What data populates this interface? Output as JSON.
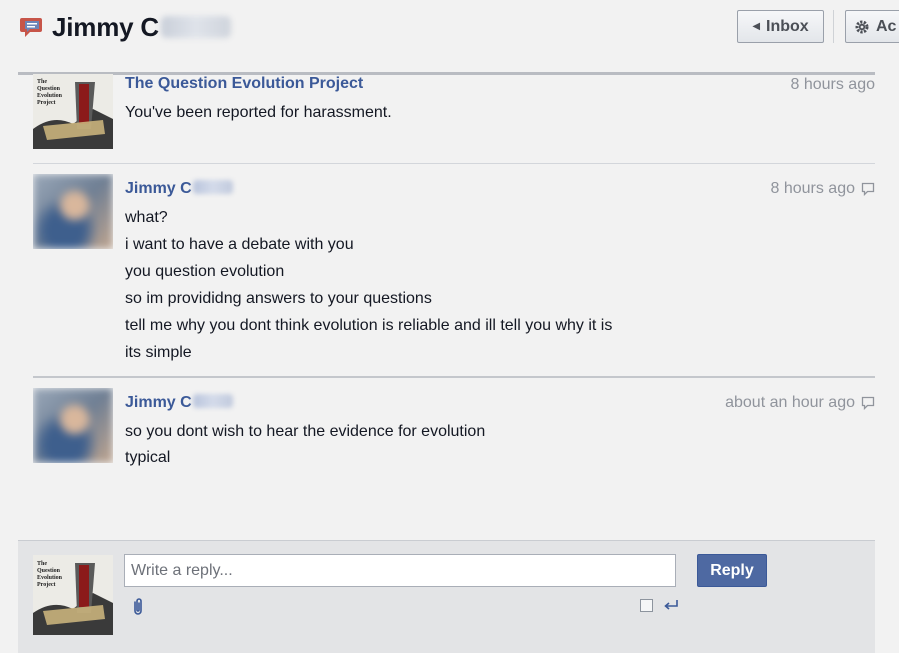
{
  "header": {
    "title": "Jimmy C",
    "inbox_label": "Inbox",
    "actions_label": "Ac"
  },
  "messages": [
    {
      "sender": "The Question Evolution Project",
      "time": "8 hours ago",
      "lines": [
        "You've been reported for harassment."
      ]
    },
    {
      "sender": "Jimmy C",
      "time": "8 hours ago",
      "lines": [
        "what?",
        "i want to have a debate with you",
        "you question evolution",
        "so im provididng answers to your questions",
        "tell me why you dont think evolution is reliable and ill tell you why it is",
        "its simple"
      ]
    },
    {
      "sender": "Jimmy C",
      "time": "about an hour ago",
      "lines": [
        "so you dont wish to hear the evidence for evolution",
        "typical"
      ]
    }
  ],
  "avatar_caption": [
    "The",
    "Question",
    "Evolution",
    "Project"
  ],
  "reply": {
    "placeholder": "Write a reply...",
    "button_label": "Reply"
  },
  "colors": {
    "link": "#3b5998",
    "button": "#4e69a2",
    "timestamp": "#90949c"
  }
}
